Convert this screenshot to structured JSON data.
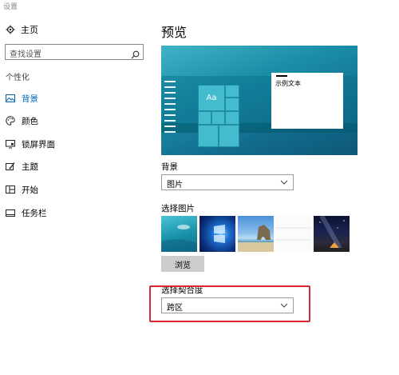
{
  "window": {
    "title": "设置"
  },
  "sidebar": {
    "home": {
      "label": "主页",
      "icon": "gear-icon"
    },
    "search": {
      "placeholder": "查找设置",
      "icon": "search-icon"
    },
    "section_heading": "个性化",
    "items": [
      {
        "label": "背景",
        "icon": "picture-icon",
        "active": true
      },
      {
        "label": "颜色",
        "icon": "palette-icon",
        "active": false
      },
      {
        "label": "锁屏界面",
        "icon": "monitor-lock-icon",
        "active": false
      },
      {
        "label": "主题",
        "icon": "theme-brush-icon",
        "active": false
      },
      {
        "label": "开始",
        "icon": "start-grid-icon",
        "active": false
      },
      {
        "label": "任务栏",
        "icon": "taskbar-icon",
        "active": false
      }
    ],
    "active_color": "#0067b8"
  },
  "main": {
    "title": "预览",
    "preview": {
      "sample_text": "示例文本",
      "tile_text": "Aa"
    },
    "background": {
      "label": "背景",
      "value": "图片"
    },
    "choose_picture": {
      "label": "选择图片",
      "thumbnails": [
        "underwater-swimmer",
        "windows-hero-blue",
        "beach-rock-arch",
        "white-panel",
        "night-sky-tent"
      ],
      "browse_label": "浏览"
    },
    "fit": {
      "label": "选择契合度",
      "value": "跨区"
    }
  },
  "annotation": {
    "highlight_color": "#d9272e"
  }
}
